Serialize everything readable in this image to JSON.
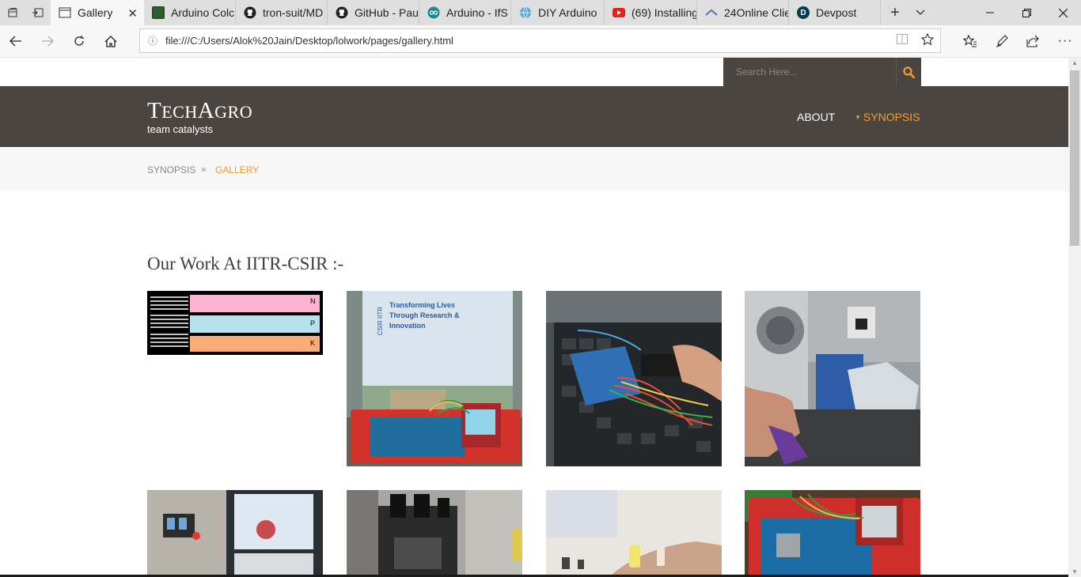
{
  "browser": {
    "tabs": [
      {
        "label": "Gallery",
        "icon": "page-icon",
        "active": true
      },
      {
        "label": "Arduino Colc",
        "icon": "arduino-forum-icon"
      },
      {
        "label": "tron-suit/MD",
        "icon": "github-icon"
      },
      {
        "label": "GitHub - Pau",
        "icon": "github-icon"
      },
      {
        "label": "Arduino - IfS",
        "icon": "arduino-icon"
      },
      {
        "label": "DIY Arduino",
        "icon": "globe-icon"
      },
      {
        "label": "(69) Installing",
        "icon": "youtube-icon"
      },
      {
        "label": "24Online Clie",
        "icon": "24online-icon"
      },
      {
        "label": "Devpost",
        "icon": "devpost-icon"
      }
    ],
    "address": "file:///C:/Users/Alok%20Jain/Desktop/lolwork/pages/gallery.html"
  },
  "page": {
    "search_placeholder": "Search Here...",
    "logo_big_t": "T",
    "logo_small_1": "ECH",
    "logo_big_a": "A",
    "logo_small_2": "GRO",
    "logo_subtitle": "team catalysts",
    "nav": {
      "about": "ABOUT",
      "synopsis": "SYNOPSIS"
    },
    "breadcrumb": {
      "parent": "SYNOPSIS",
      "separator": "»",
      "current": "GALLERY"
    },
    "section_title": "Our Work At IITR-CSIR :-",
    "npk_labels": [
      "N",
      "P",
      "K"
    ],
    "banner_lines": [
      "Transforming Lives",
      "Through Research &",
      "Innovation"
    ],
    "banner_logo": "CSIR IITR",
    "colors": {
      "accent": "#f39c2f",
      "header_bg": "#4a4541"
    }
  }
}
